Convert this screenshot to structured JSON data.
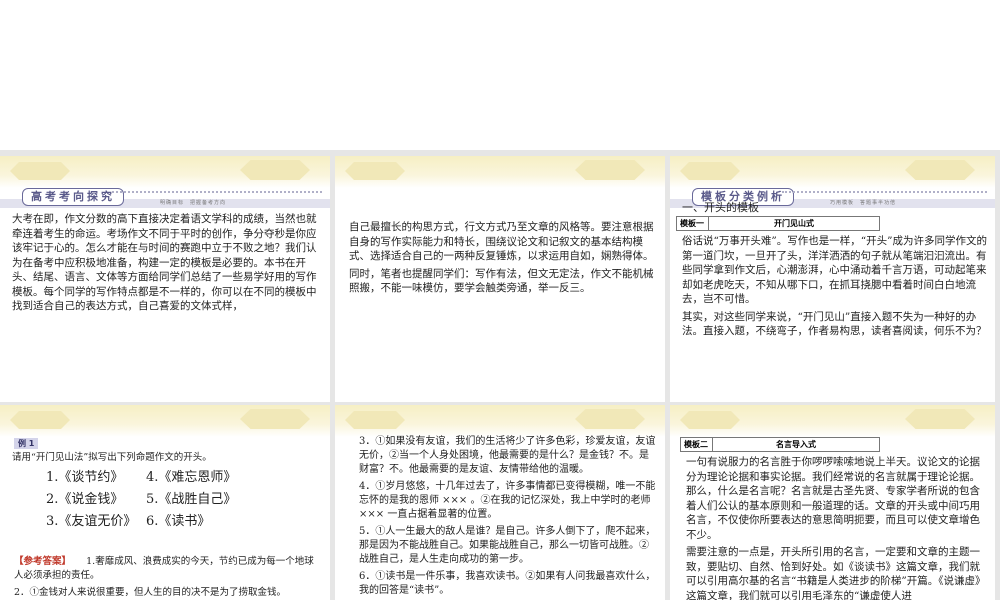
{
  "slides": {
    "s1": {
      "banner": "高考考向探究",
      "banner_sub": "明确目标　把握备考方向",
      "text": "大考在即，作文分数的高下直接决定着语文学科的成绩，当然也就牵连着考生的命运。考场作文不同于平时的创作，争分夺秒是你应该牢记于心的。怎么才能在与时间的赛跑中立于不败之地？我们认为在备考中应积极地准备，构建一定的模板是必要的。本书在开头、结尾、语言、文体等方面给同学们总结了一些易学好用的写作模板。每个同学的写作特点都是不一样的，你可以在不同的模板中找到适合自己的表达方式，自己喜爱的文体式样，"
    },
    "s2": {
      "p1": "自己最擅长的构思方式，行文方式乃至文章的风格等。要注意根据自身的写作实际能力和特长，围绕议论文和记叙文的基本结构模式、选择适合自己的一两种反复锤炼，以求运用自如，娴熟得体。",
      "p2": "同时，笔者也提醒同学们：写作有法，但文无定法，作文不能机械照搬，不能一味模仿，要学会触类旁通，举一反三。"
    },
    "s3": {
      "banner": "模板分类例析",
      "banner_sub": "巧用模板　答题事半功倍",
      "heading": "一、开头的模板",
      "table_key": "模板一",
      "table_val": "开门见山式",
      "p1": "俗话说“万事开头难”。写作也是一样，“开头”成为许多同学作文的第一道门坎，一旦开了头，洋洋洒洒的句子就从笔端汩汩流出。有些同学拿到作文后，心潮澎湃，心中涌动着千言万语，可动起笔来却如老虎吃天，不知从哪下口，在抓耳挠腮中看着时间白白地流去，岂不可惜。",
      "p2": "其实，对这些同学来说，“开门见山”直接入题不失为一种好的办法。直接入题，不绕弯子，作者易构思，读者喜阅读，何乐不为？"
    },
    "s4": {
      "example": "例 1",
      "prompt": "请用“开门见山法”拟写出下列命题作文的开头。",
      "titles": [
        "1.《谈节约》",
        "4.《难忘恩师》",
        "2.《说金钱》",
        "5.《战胜自己》",
        "3.《友谊无价》",
        "6.《读书》"
      ],
      "answer_label": "【参考答案】",
      "a1": "1.奢靡成风、浪费成实的今天，节约已成为每一个地球人必须承担的责任。",
      "a2": "2．①金钱对人来说很重要，但人生的目的决不是为了捞取金钱。"
    },
    "s5": {
      "a3": "3．①如果没有友谊，我们的生活将少了许多色彩，珍爱友谊，友谊无价，②当一个人身处困境，他最需要的是什么？是金钱？不。是财富？不。他最需要的是友谊、友情带给他的温暖。",
      "a4": "4．①岁月悠悠，十几年过去了，许多事情都已变得模糊，唯一不能忘怀的是我的恩师 ××× 。②在我的记忆深处，我上中学时的老师 ××× 一直占据着显著的位置。",
      "a5": "5．①人一生最大的敌人是谁？是自己。许多人倒下了，爬不起来，那是因为不能战胜自己。如果能战胜自己，那么一切皆可战胜。②战胜自己，是人生走向成功的第一步。",
      "a6": "6．①读书是一件乐事，我喜欢读书。②如果有人问我最喜欢什么，我的回答是“读书”。"
    },
    "s6": {
      "table_key": "模板二",
      "table_val": "名言导入式",
      "p1": "一句有说服力的名言胜于你啰啰嗦嗦地说上半天。议论文的论据分为理论论据和事实论据。我们经常说的名言就属于理论论据。那么，什么是名言呢？名言就是古圣先贤、专家学者所说的包含着人们公认的基本原则和一般道理的话。文章的开头或中间巧用名言，不仅使你所要表达的意思简明扼要，而且可以使文章增色不少。",
      "p2": "需要注意的一点是，开头所引用的名言，一定要和文章的主题一致，要贴切、自然、恰到好处。如《谈读书》这篇文章，我们就可以引用高尔基的名言“书籍是人类进步的阶梯”开篇。《说谦虚》这篇文章，我们就可以引用毛泽东的“谦虚使人进"
    }
  }
}
